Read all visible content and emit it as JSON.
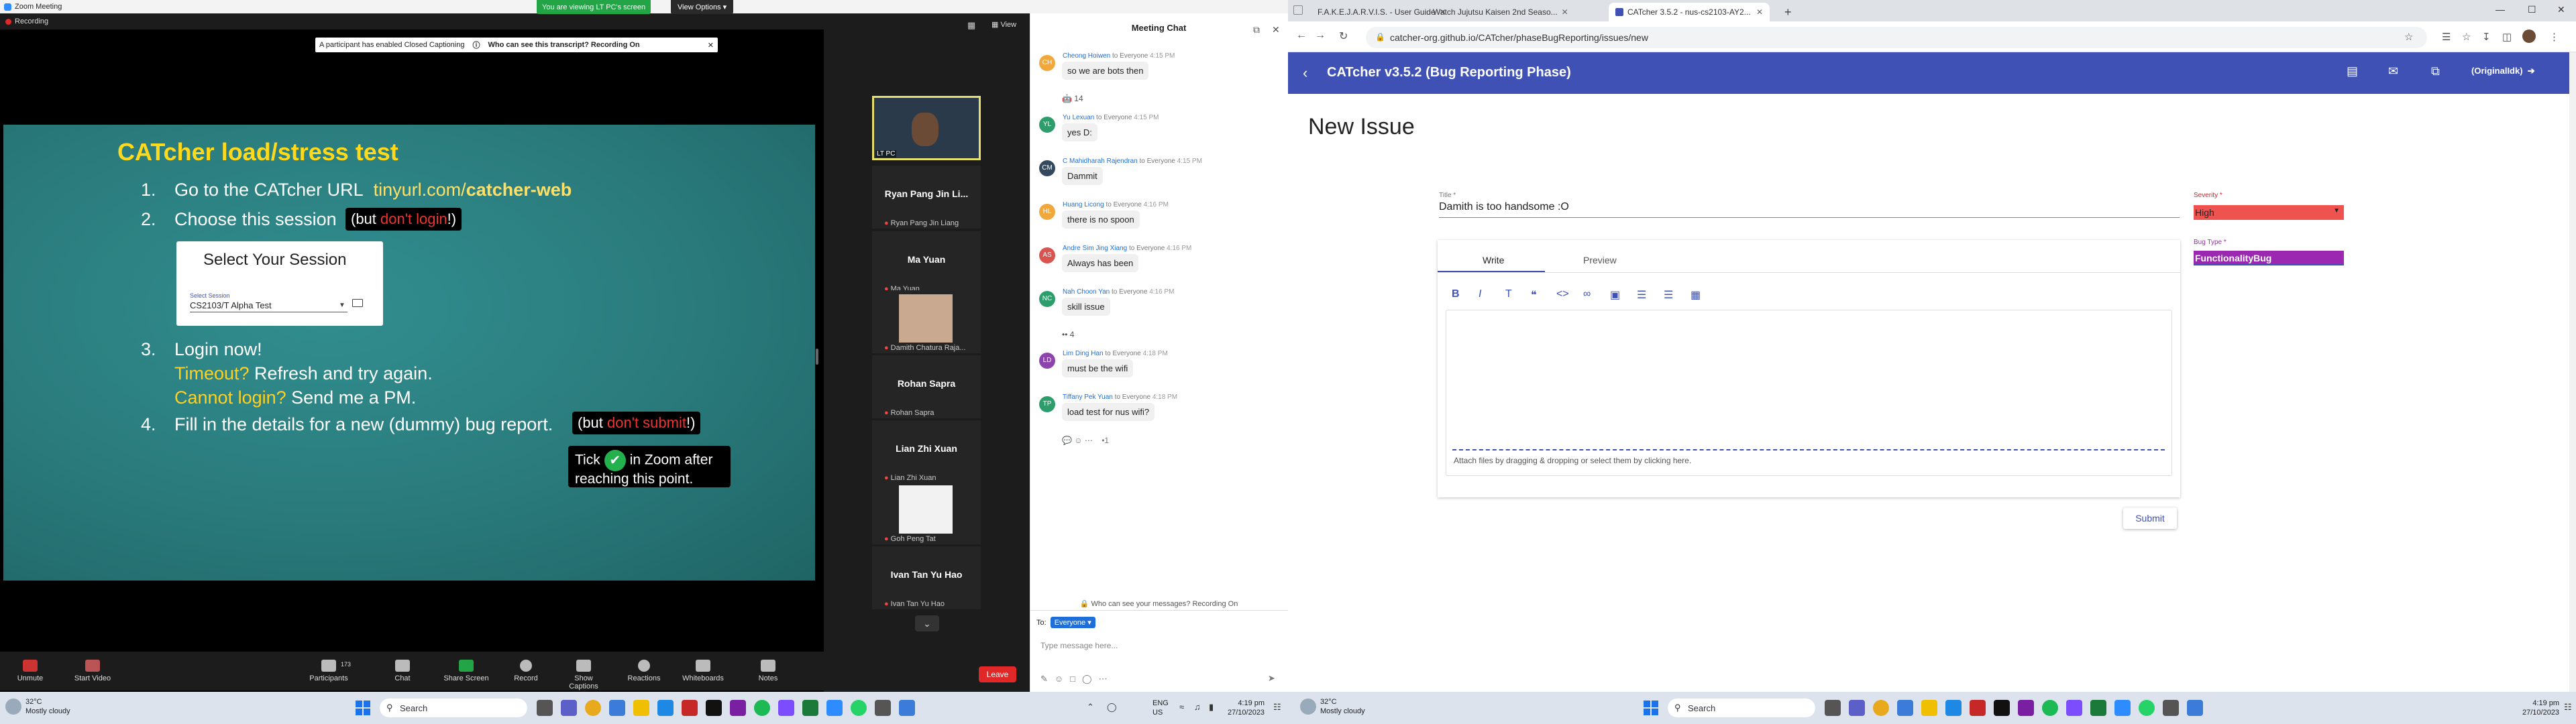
{
  "zoom": {
    "window_title": "Zoom Meeting",
    "recording_label": "Recording",
    "viewing_banner": "You are viewing LT PC's screen",
    "view_options": "View Options",
    "view_label": "View",
    "cc_notice": "A participant has enabled Closed Captioning",
    "cc_link": "Who can see this transcript? Recording On",
    "slide": {
      "title": "CATcher load/stress test",
      "l1_num": "1.",
      "l1_text": "Go to the CATcher URL",
      "l1_link_a": "tinyurl.com/",
      "l1_link_b": "catcher-web",
      "l2_num": "2.",
      "l2_text": "Choose this session",
      "l2_callout_a": "(but ",
      "l2_callout_b": "don't login",
      "l2_callout_c": "!)",
      "session_heading": "Select Your Session",
      "session_label": "Select Session",
      "session_value": "CS2103/T Alpha Test",
      "l3_num": "3.",
      "l3_text": "Login now!",
      "timeout_a": "Timeout?",
      "timeout_b": " Refresh and try again.",
      "cannot_a": "Cannot login?",
      "cannot_b": " Send me a PM.",
      "l4_num": "4.",
      "l4_text": "Fill in the details for a new (dummy) bug report.",
      "l4_callout_a": "(but ",
      "l4_callout_b": "don't submit",
      "l4_callout_c": "!)",
      "tick_a": "Tick",
      "tick_b": "in Zoom after",
      "tick_c": "reaching this point."
    },
    "gallery": {
      "self_label": "LT PC",
      "tiles": [
        {
          "name": "Ryan Pang Jin Li...",
          "sub": "Ryan Pang Jin Liang"
        },
        {
          "name": "Ma Yuan",
          "sub": "Ma Yuan"
        },
        {
          "name": "",
          "sub": "Damith Chatura Raja..."
        },
        {
          "name": "Rohan Sapra",
          "sub": "Rohan Sapra"
        },
        {
          "name": "Lian Zhi Xuan",
          "sub": "Lian Zhi Xuan"
        },
        {
          "name": "",
          "sub": "Goh Peng Tat"
        },
        {
          "name": "Ivan Tan Yu Hao",
          "sub": "Ivan Tan Yu Hao"
        }
      ]
    },
    "toolbar": {
      "unmute": "Unmute",
      "start_video": "Start Video",
      "participants": "Participants",
      "participants_count": "173",
      "chat": "Chat",
      "share_screen": "Share Screen",
      "record": "Record",
      "show_captions": "Show Captions",
      "reactions": "Reactions",
      "whiteboards": "Whiteboards",
      "notes": "Notes",
      "leave": "Leave"
    }
  },
  "chat": {
    "header": "Meeting Chat",
    "messages": [
      {
        "initials": "CH",
        "color": "#f0a83c",
        "sender": "Cheong Hoiwen",
        "to": "to Everyone",
        "time": "4:15 PM",
        "text": "so we are bots then"
      },
      {
        "initials": "YL",
        "color": "#2e9d6c",
        "sender": "Yu Lexuan",
        "to": "to Everyone",
        "time": "4:15 PM",
        "text": "yes D:"
      },
      {
        "initials": "CM",
        "color": "#34495e",
        "sender": "C Mahidharah Rajendran",
        "to": "to Everyone",
        "time": "4:15 PM",
        "text": "Dammit"
      },
      {
        "initials": "HL",
        "color": "#f0a83c",
        "sender": "Huang Licong",
        "to": "to Everyone",
        "time": "4:16 PM",
        "text": "there is no spoon"
      },
      {
        "initials": "AS",
        "color": "#d9534f",
        "sender": "Andre Sim Jing Xiang",
        "to": "to Everyone",
        "time": "4:16 PM",
        "text": "Always has been"
      },
      {
        "initials": "NC",
        "color": "#2e9d6c",
        "sender": "Nah Choon Yan",
        "to": "to Everyone",
        "time": "4:16 PM",
        "text": "skill issue"
      },
      {
        "initials": "LD",
        "color": "#8e44ad",
        "sender": "Lim Ding Han",
        "to": "to Everyone",
        "time": "4:18 PM",
        "text": "must be the wifi"
      },
      {
        "initials": "TP",
        "color": "#2e9d6c",
        "sender": "Tiffany Pek Yuan",
        "to": "to Everyone",
        "time": "4:18 PM",
        "text": "load test for nus wifi?"
      }
    ],
    "reaction_1": "🤖 14",
    "reaction_2": "•• 4",
    "note": "Who can see your messages? Recording On",
    "to_label": "To:",
    "to_value": "Everyone",
    "input_placeholder": "Type message here..."
  },
  "browser": {
    "tabs": [
      {
        "title": "F.A.K.E.J.A.R.V.I.S. - User Guide",
        "color": "#4caf50"
      },
      {
        "title": "Watch Jujutsu Kaisen 2nd Seaso...",
        "color": "#2bb24c"
      },
      {
        "title": "CATcher 3.5.2 - nus-cs2103-AY2...",
        "color": "#3f51b5"
      }
    ],
    "url": "catcher-org.github.io/CATcher/phaseBugReporting/issues/new"
  },
  "catcher": {
    "app_title": "CATcher v3.5.2  (Bug Reporting Phase)",
    "user": "(OriginalIdk)",
    "page_heading": "New Issue",
    "title_label": "Title *",
    "title_value": "Damith is too handsome :O",
    "severity_label": "Severity *",
    "severity_value": "High",
    "bugtype_label": "Bug Type *",
    "bugtype_value": "FunctionalityBug",
    "tab_write": "Write",
    "tab_preview": "Preview",
    "attach_hint": "Attach files by dragging & dropping or select them by clicking here.",
    "submit": "Submit",
    "colors": {
      "primary": "#3f51b5",
      "severity": "#ef5350",
      "bugtype": "#9c27b0"
    }
  },
  "taskbar_left": {
    "temp": "32°C",
    "weather": "Mostly cloudy",
    "search": "Search",
    "lang_a": "ENG",
    "lang_b": "US",
    "time": "4:19 pm",
    "date": "27/10/2023"
  },
  "taskbar_right": {
    "temp": "32°C",
    "weather": "Mostly cloudy",
    "search": "Search",
    "time": "4:19 pm",
    "date": "27/10/2023"
  }
}
